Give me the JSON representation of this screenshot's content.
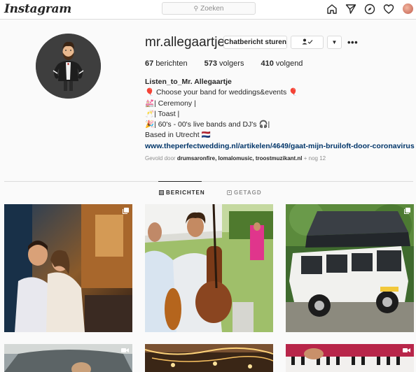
{
  "app": {
    "logo_text": "Instagram"
  },
  "search": {
    "placeholder": "Zoeken"
  },
  "profile": {
    "username": "mr.allegaartje",
    "message_button": "Chatbericht sturen",
    "stats": [
      {
        "count": "67",
        "label": "berichten"
      },
      {
        "count": "573",
        "label": "volgers"
      },
      {
        "count": "410",
        "label": "volgend"
      }
    ],
    "bio": {
      "name": "Listen_to_Mr. Allegaartje",
      "lines": [
        "🎈 Choose your band for weddings&events 🎈",
        "💒| Ceremony |",
        "🥂| Toast |",
        "🎉| 60's - 00's live bands and DJ's 🎧|",
        "Based in Utrecht 🇳🇱"
      ],
      "link": "www.theperfectwedding.nl/artikelen/4649/gaat-mijn-bruiloft-door-coronavirus"
    },
    "followed_by": {
      "prefix": "Gevold door",
      "names": "drumsaronfire, lomalomusic, troostmuzikant.nl",
      "suffix": "+ nog 12"
    }
  },
  "tabs": [
    {
      "label": "BERICHTEN",
      "active": true
    },
    {
      "label": "GETAGD",
      "active": false
    }
  ],
  "icons": {
    "home": "home-icon",
    "direct": "paper-plane-icon",
    "explore": "compass-icon",
    "activity": "heart-icon",
    "search": "magnifier-icon",
    "multi": "multiple-images-icon",
    "video": "video-camera-icon"
  },
  "colors": {
    "link": "#003569",
    "border": "#dbdbdb",
    "background": "#fafafa"
  }
}
